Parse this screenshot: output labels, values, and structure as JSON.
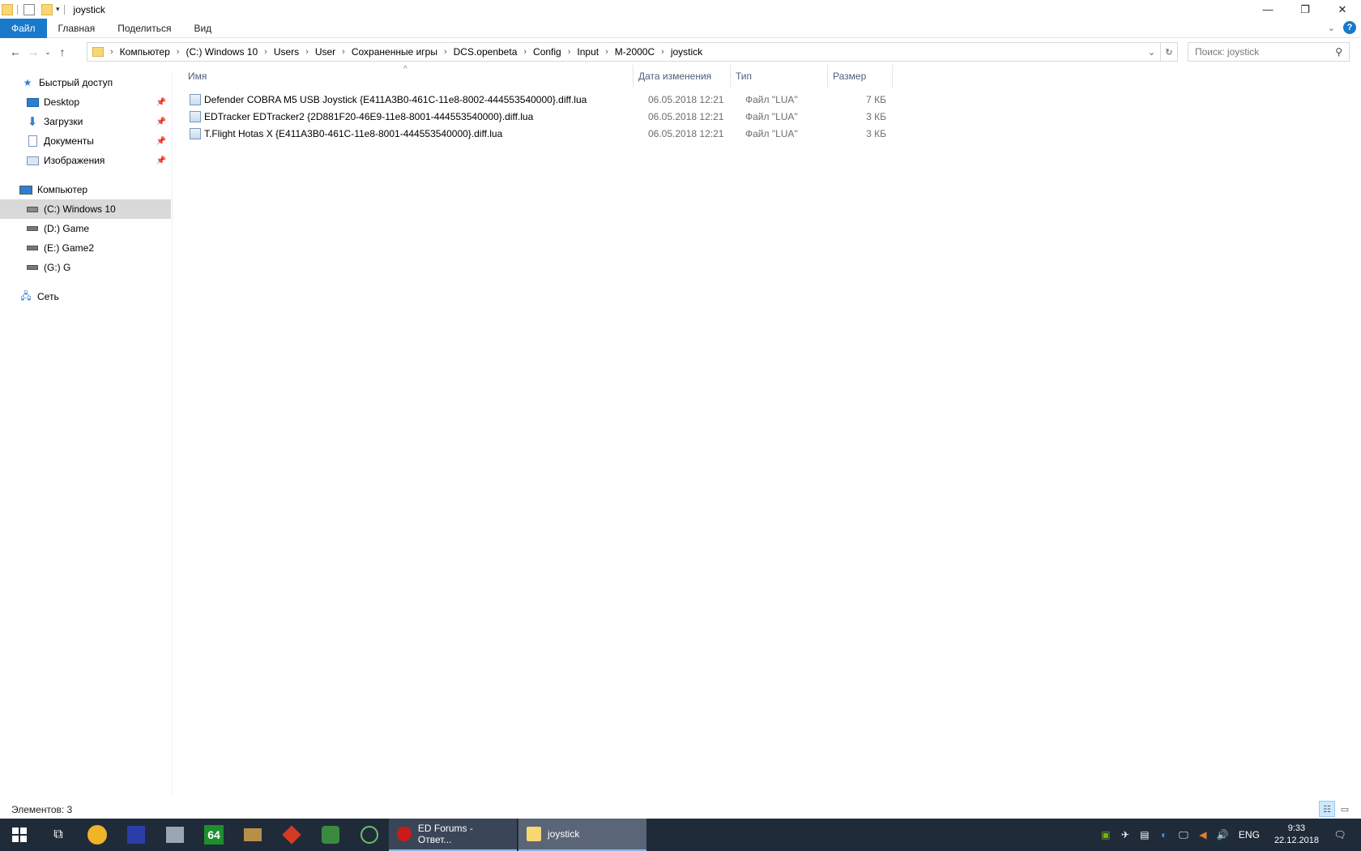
{
  "window": {
    "title": "joystick",
    "controls": {
      "minimize": "—",
      "restore": "❐",
      "close": "✕"
    }
  },
  "ribbon": {
    "tabs": [
      "Файл",
      "Главная",
      "Поделиться",
      "Вид"
    ]
  },
  "address": {
    "crumbs": [
      "Компьютер",
      "(C:) Windows 10",
      "Users",
      "User",
      "Сохраненные игры",
      "DCS.openbeta",
      "Config",
      "Input",
      "M-2000C",
      "joystick"
    ]
  },
  "search": {
    "placeholder": "Поиск: joystick"
  },
  "navpane": {
    "quick_access": "Быстрый доступ",
    "pinned": [
      "Desktop",
      "Загрузки",
      "Документы",
      "Изображения"
    ],
    "computer": "Компьютер",
    "drives": [
      "(C:) Windows 10",
      "(D:) Game",
      "(E:) Game2",
      "(G:) G"
    ],
    "network": "Сеть"
  },
  "columns": {
    "name": "Имя",
    "date": "Дата изменения",
    "type": "Тип",
    "size": "Размер"
  },
  "files": [
    {
      "name": "Defender COBRA M5 USB Joystick {E411A3B0-461C-11e8-8002-444553540000}.diff.lua",
      "date": "06.05.2018 12:21",
      "type": "Файл \"LUA\"",
      "size": "7 КБ"
    },
    {
      "name": "EDTracker EDTracker2 {2D881F20-46E9-11e8-8001-444553540000}.diff.lua",
      "date": "06.05.2018 12:21",
      "type": "Файл \"LUA\"",
      "size": "3 КБ"
    },
    {
      "name": "T.Flight Hotas X {E411A3B0-461C-11e8-8001-444553540000}.diff.lua",
      "date": "06.05.2018 12:21",
      "type": "Файл \"LUA\"",
      "size": "3 КБ"
    }
  ],
  "status": {
    "count": "Элементов: 3"
  },
  "taskbar": {
    "pinned_badge": "64",
    "apps": [
      {
        "label": "ED Forums - Ответ...",
        "color": "#cc1a1a"
      },
      {
        "label": "joystick",
        "color": "#f8d775"
      }
    ],
    "tray": {
      "lang": "ENG",
      "time": "9:33",
      "date": "22.12.2018"
    }
  }
}
